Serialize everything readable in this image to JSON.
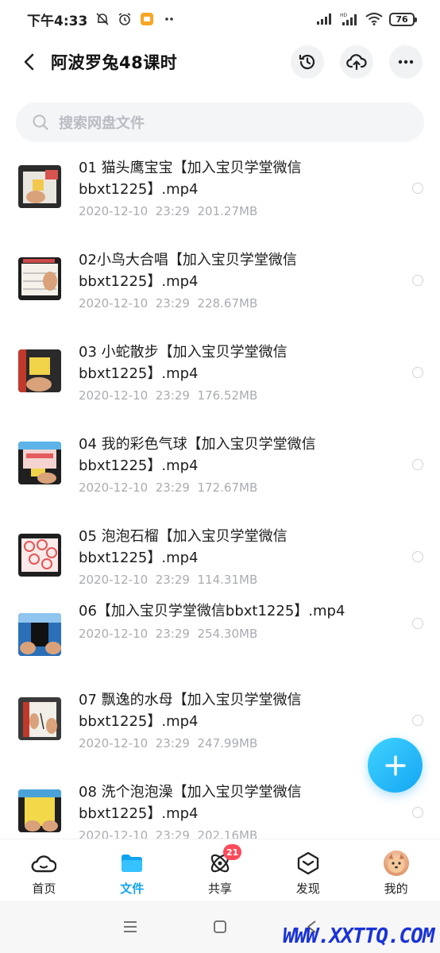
{
  "status_bar": {
    "time": "下午4:33",
    "battery": "76",
    "left_icons": [
      "bell-muted-icon",
      "alarm-icon",
      "app-notification-icon",
      "more-dots-icon"
    ],
    "right_icons": [
      "signal-icon",
      "hd-signal-icon",
      "wifi-icon",
      "battery-icon"
    ]
  },
  "header": {
    "title": "阿波罗兔48课时",
    "actions": [
      "history-icon",
      "cloud-upload-icon",
      "more-icon"
    ]
  },
  "search": {
    "placeholder": "搜索网盘文件"
  },
  "files": [
    {
      "name": "01 猫头鹰宝宝【加入宝贝学堂微信bbxt1225】.mp4",
      "date": "2020-12-10",
      "time": "23:29",
      "size": "201.27MB"
    },
    {
      "name": "02小鸟大合唱【加入宝贝学堂微信bbxt1225】.mp4",
      "date": "2020-12-10",
      "time": "23:29",
      "size": "228.67MB"
    },
    {
      "name": "03 小蛇散步【加入宝贝学堂微信bbxt1225】.mp4",
      "date": "2020-12-10",
      "time": "23:29",
      "size": "176.52MB"
    },
    {
      "name": "04 我的彩色气球【加入宝贝学堂微信bbxt1225】.mp4",
      "date": "2020-12-10",
      "time": "23:29",
      "size": "172.67MB"
    },
    {
      "name": "05 泡泡石榴【加入宝贝学堂微信bbxt1225】.mp4",
      "date": "2020-12-10",
      "time": "23:29",
      "size": "114.31MB"
    },
    {
      "name": "06【加入宝贝学堂微信bbxt1225】.mp4",
      "date": "2020-12-10",
      "time": "23:29",
      "size": "254.30MB"
    },
    {
      "name": "07 飘逸的水母【加入宝贝学堂微信bbxt1225】.mp4",
      "date": "2020-12-10",
      "time": "23:29",
      "size": "247.99MB"
    },
    {
      "name": "08 洗个泡泡澡【加入宝贝学堂微信bbxt1225】.mp4",
      "date": "2020-12-10",
      "time": "23:29",
      "size": "202.16MB"
    }
  ],
  "bottom_nav": [
    {
      "label": "首页",
      "icon": "cloud-home-icon",
      "active": false
    },
    {
      "label": "文件",
      "icon": "folder-icon",
      "active": true
    },
    {
      "label": "共享",
      "icon": "share-orbit-icon",
      "active": false,
      "badge": "21"
    },
    {
      "label": "发现",
      "icon": "discover-cube-icon",
      "active": false
    },
    {
      "label": "我的",
      "icon": "avatar",
      "active": false
    }
  ],
  "system_nav": [
    "menu-icon",
    "home-square-icon",
    "back-triangle-icon"
  ],
  "watermark": "WWW.XXTTQ.COM",
  "colors": {
    "accent": "#10a4f0",
    "badge": "#ff4a5a",
    "meta_text": "#a9acb2"
  }
}
